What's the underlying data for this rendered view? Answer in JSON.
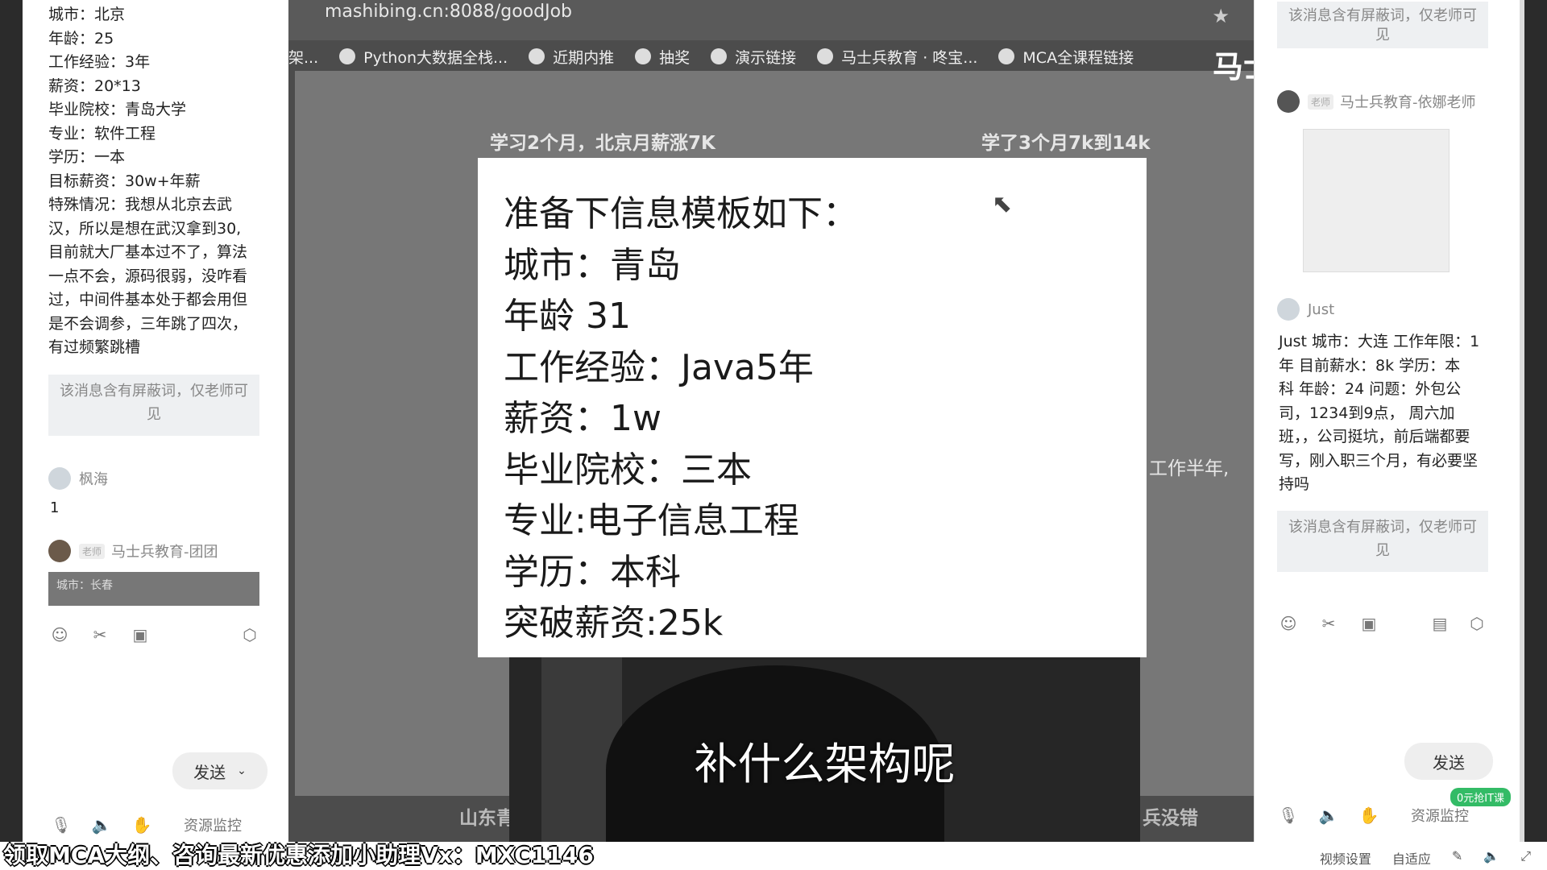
{
  "left_panel": {
    "message_lines": [
      "城市：北京",
      "年龄：25",
      "工作经验：3年",
      "薪资：20*13",
      "毕业院校：青岛大学",
      "专业：软件工程",
      "学历：一本",
      "目标薪资：30w+年薪",
      "特殊情况：我想从北京去武",
      "汉，所以是想在武汉拿到30,",
      "目前就大厂基本过不了，算法",
      "一点不会，源码很弱，没咋看",
      "过，中间件基本处于都会用但",
      "是不会调参，三年跳了四次，",
      "有过频繁跳槽"
    ],
    "blocked_notice": "该消息含有屏蔽词，仅老师可见",
    "user1_name": "枫海",
    "user1_message": "1",
    "teacher_tag": "老师",
    "teacher_name": "马士兵教育-团团",
    "preview_snippet": "城市：长春",
    "send_label": "发送",
    "resource_monitor": "资源监控"
  },
  "browser": {
    "url": "mashibing.cn:8088/goodJob",
    "bookmarks": [
      "架...",
      "Python大数据全栈...",
      "近期内推",
      "抽奖",
      "演示链接",
      "马士兵教育 · 咚宝...",
      "MCA全课程链接"
    ]
  },
  "web": {
    "heading_left": "学习2个月，北京月薪涨7K",
    "heading_right": "学了3个月7k到14k",
    "partial_right": "工作半年,",
    "strip_left": "山东青",
    "strip_right": "兵没错"
  },
  "overlay_card": {
    "lines": [
      "准备下信息模板如下：",
      "城市：青岛",
      "年龄 31",
      "工作经验：Java5年",
      "薪资：1w",
      "毕业院校：三本",
      "专业:电子信息工程",
      "学历：本科",
      "突破薪资:25k"
    ]
  },
  "webcam": {
    "subtitle": "补什么架构呢"
  },
  "brand": "马士兵官·腾讯课堂",
  "right_panel": {
    "blocked_notice": "该消息含有屏蔽词，仅老师可见",
    "teacher_tag": "老师",
    "teacher_name": "马士兵教育-依娜老师",
    "user_name": "Just",
    "message_lines": [
      "Just 城市：大连 工作年限：1",
      "年 目前薪水：8k 学历：本",
      "科 年龄：24 问题：外包公",
      "司，1234到9点， 周六加",
      "班，，公司挺坑，前后端都要",
      "写，刚入职三个月，有必要坚",
      "持吗"
    ],
    "send_label": "发送",
    "resource_monitor": "资源监控",
    "badge": "0元抢IT课"
  },
  "bottom": {
    "promo": "领取MCA大纲、咨询最新优惠添加小助理Vx：MXC1146",
    "video_settings": "视频设置",
    "auto_fit": "自适应"
  }
}
